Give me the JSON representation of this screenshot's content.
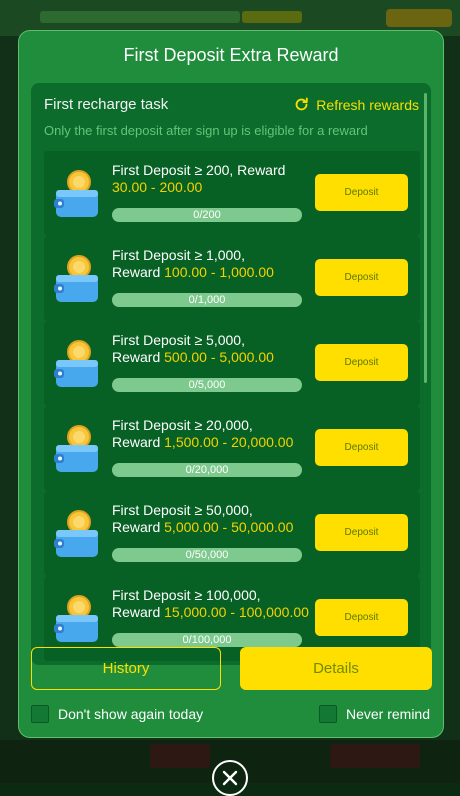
{
  "modal": {
    "title": "First Deposit Extra Reward",
    "task_title": "First recharge task",
    "refresh_label": "Refresh rewards",
    "note": "Only the first deposit after sign up is eligible for a reward",
    "tasks": [
      {
        "line1": "First Deposit ≥ 200, Reward",
        "line2": "",
        "reward": "30.00 - 200.00",
        "progress": "0/200",
        "progress_fraction": 0,
        "button": "Deposit"
      },
      {
        "line1": "First Deposit ≥ 1,000,",
        "line2": "Reward",
        "reward": "100.00 - 1,000.00",
        "progress": "0/1,000",
        "progress_fraction": 0,
        "button": "Deposit"
      },
      {
        "line1": "First Deposit ≥ 5,000,",
        "line2": "Reward",
        "reward": "500.00 - 5,000.00",
        "progress": "0/5,000",
        "progress_fraction": 0,
        "button": "Deposit"
      },
      {
        "line1": "First Deposit ≥ 20,000,",
        "line2": "Reward",
        "reward": "1,500.00 - 20,000.00",
        "progress": "0/20,000",
        "progress_fraction": 0,
        "button": "Deposit"
      },
      {
        "line1": "First Deposit ≥ 50,000,",
        "line2": "Reward",
        "reward": "5,000.00 - 50,000.00",
        "progress": "0/50,000",
        "progress_fraction": 0,
        "button": "Deposit"
      },
      {
        "line1": "First Deposit ≥ 100,000,",
        "line2": "Reward",
        "reward": "15,000.00 - 100,000.00",
        "progress": "0/100,000",
        "progress_fraction": 0,
        "button": "Deposit"
      }
    ],
    "history_label": "History",
    "details_label": "Details",
    "dont_show_label": "Don't show again today",
    "never_remind_label": "Never remind"
  },
  "icons": {
    "refresh": "refresh-icon",
    "wallet": "wallet-coin-icon",
    "close": "close-icon"
  },
  "colors": {
    "modal_bg": "#1f8d3c",
    "accent_yellow": "#ffdf00",
    "reward_text": "#f4d200"
  }
}
